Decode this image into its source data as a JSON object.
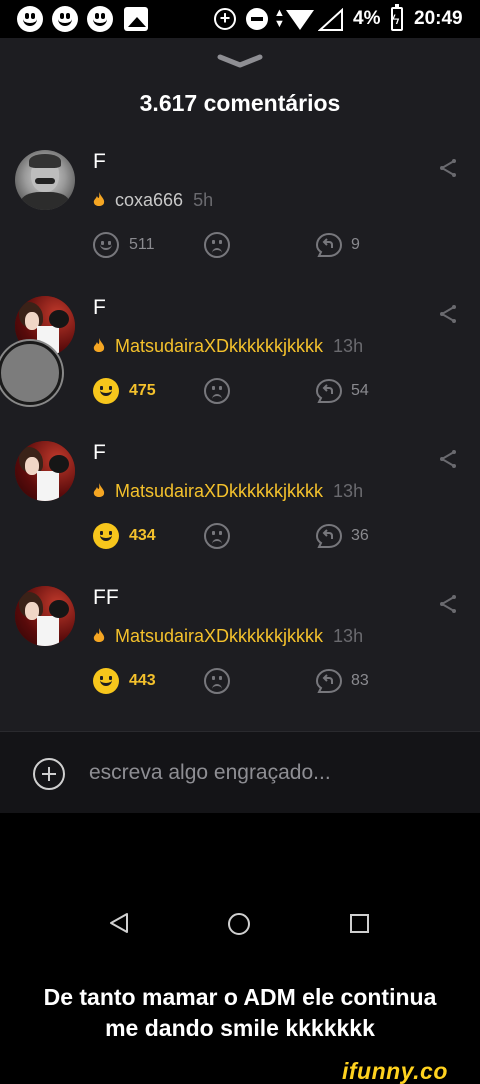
{
  "status_bar": {
    "battery_percent": "4%",
    "time": "20:49",
    "icons": [
      "smiley-icon",
      "smiley-icon",
      "smiley-icon",
      "image-icon",
      "data-saver-icon",
      "do-not-disturb-icon",
      "data-arrows-icon",
      "wifi-icon",
      "signal-icon",
      "battery-charging-icon"
    ]
  },
  "sheet": {
    "title": "3.617 comentários"
  },
  "comments": [
    {
      "text": "F",
      "author": "coxa666",
      "time": "5h",
      "smiles": "511",
      "smiled": false,
      "replies": "9",
      "avatar": "stalin-portrait"
    },
    {
      "text": "F",
      "author": "MatsudairaXDkkkkkkjkkkk",
      "time": "13h",
      "smiles": "475",
      "smiled": true,
      "replies": "54",
      "avatar": "anime-characters"
    },
    {
      "text": "F",
      "author": "MatsudairaXDkkkkkkjkkkk",
      "time": "13h",
      "smiles": "434",
      "smiled": true,
      "replies": "36",
      "avatar": "anime-characters"
    },
    {
      "text": "FF",
      "author": "MatsudairaXDkkkkkkjkkkk",
      "time": "13h",
      "smiles": "443",
      "smiled": true,
      "replies": "83",
      "avatar": "anime-characters"
    }
  ],
  "input": {
    "placeholder": "escreva algo engraçado..."
  },
  "caption": {
    "line1": "De tanto mamar o ADM ele continua",
    "line2": "me dando smile kkkkkkk"
  },
  "watermark": "ifunny.co",
  "colors": {
    "sheet_bg": "#1d1d21",
    "gold": "#f4c12c",
    "smile_yellow": "#f7c61c",
    "flame_orange": "#f5a623",
    "watermark_yellow": "#ffd21f"
  }
}
